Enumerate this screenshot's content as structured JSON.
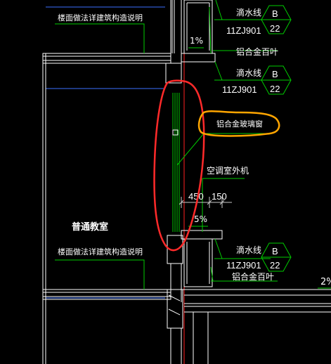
{
  "labels": {
    "floor_note_top": "楼面做法详建筑构造说明",
    "floor_note_bottom": "楼面做法详建筑构造说明",
    "room_name": "普通教室",
    "drip_line_1": "滴水线",
    "drip_line_2": "滴水线",
    "drip_line_3": "滴水线",
    "ref_code_1": "11ZJ901",
    "ref_code_2": "11ZJ901",
    "ref_code_3": "11ZJ901",
    "ref_letter_1": "B",
    "ref_letter_2": "B",
    "ref_letter_3": "B",
    "ref_num_1": "22",
    "ref_num_2": "22",
    "ref_num_3": "22",
    "louver_top": "铝合金百叶",
    "louver_bottom": "铝合金百叶",
    "glass_window": "铝合金玻璃窗",
    "ac_unit": "空调室外机",
    "slope_top": "1%",
    "slope_mid": "5%",
    "slope_right": "2%",
    "dim_450": "450",
    "dim_150": "150"
  },
  "colors": {
    "background": "#000000",
    "structure": "#ffffff",
    "leader": "#00cc00",
    "red_line": "#ff2020",
    "highlight_red": "#ff2a2a",
    "highlight_orange": "#ffa500",
    "guide": "#3a6fff",
    "dim": "#c8c8c8"
  }
}
